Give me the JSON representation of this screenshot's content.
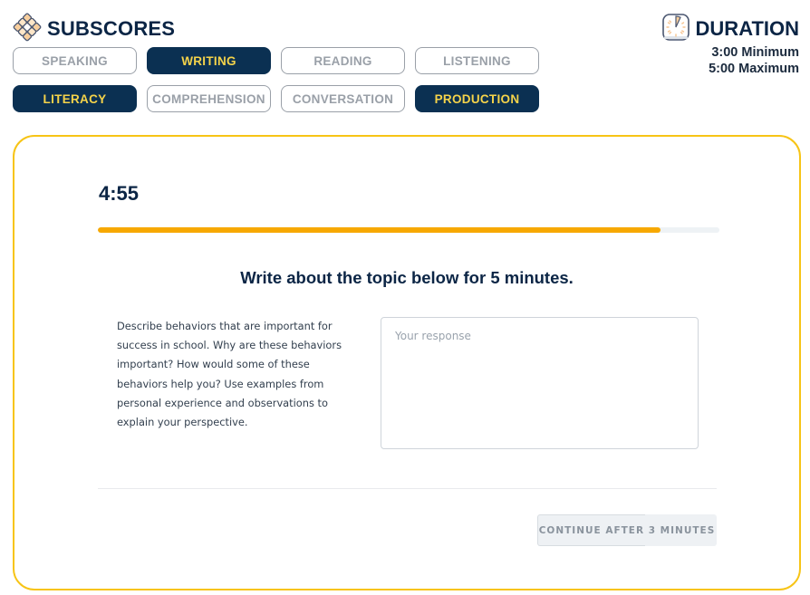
{
  "header": {
    "subscores_title": "SUBSCORES",
    "subscores_icon": "diamond-grid-icon",
    "skills": [
      {
        "label": "SPEAKING",
        "active": false
      },
      {
        "label": "WRITING",
        "active": true
      },
      {
        "label": "READING",
        "active": false
      },
      {
        "label": "LISTENING",
        "active": false
      }
    ],
    "subskills": [
      {
        "label": "LITERACY",
        "active": true
      },
      {
        "label": "COMPREHENSION",
        "active": false
      },
      {
        "label": "CONVERSATION",
        "active": false
      },
      {
        "label": "PRODUCTION",
        "active": true
      }
    ],
    "duration": {
      "title": "DURATION",
      "icon": "clock-icon",
      "minimum": "3:00 Minimum",
      "maximum": "5:00 Maximum"
    }
  },
  "question": {
    "timer": "4:55",
    "timer_progress": 0.905,
    "instruction": "Write about the topic below for 5 minutes.",
    "prompt": "Describe behaviors that are important for success in school. Why are these behaviors important? How would some of these behaviors help you? Use examples from personal experience and observations to explain your perspective.",
    "response": {
      "value": "",
      "placeholder": "Your response"
    },
    "continue_button": {
      "label": "CONTINUE AFTER 3 MINUTES",
      "enabled": false,
      "wait_progress": 0.6
    }
  },
  "colors": {
    "navy": "#0b3052",
    "yellow_text": "#f5d34a",
    "card_border": "#f7c416",
    "progress": "#f7a800",
    "muted": "#9aa0a8"
  }
}
